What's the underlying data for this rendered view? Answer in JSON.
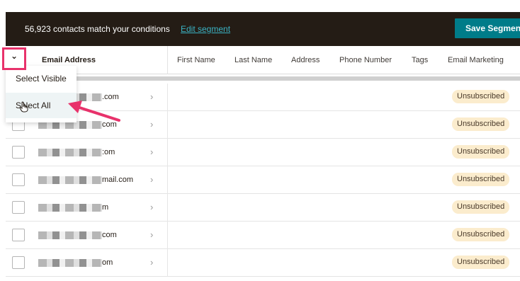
{
  "toolbar": {
    "match_text": "56,923 contacts match your conditions",
    "edit_link": "Edit segment",
    "save_label": "Save Segment"
  },
  "table": {
    "columns": [
      "Email Address",
      "First Name",
      "Last Name",
      "Address",
      "Phone Number",
      "Tags",
      "Email Marketing"
    ],
    "rows": [
      {
        "email_domain": ".com",
        "status": "Unsubscribed"
      },
      {
        "email_domain": "com",
        "status": "Unsubscribed"
      },
      {
        "email_domain": ":om",
        "status": "Unsubscribed"
      },
      {
        "email_domain": "mail.com",
        "status": "Unsubscribed"
      },
      {
        "email_domain": "m",
        "status": "Unsubscribed"
      },
      {
        "email_domain": "com",
        "status": "Unsubscribed"
      },
      {
        "email_domain": "om",
        "status": "Unsubscribed"
      }
    ]
  },
  "select_menu": {
    "toggle_icon": "chevron-down-icon",
    "items": [
      "Select Visible",
      "Select All"
    ]
  },
  "colors": {
    "topbar": "#241c15",
    "save_button": "#007c89",
    "link": "#3ab3c4",
    "highlight": "#e8326b",
    "badge_bg": "#fbeccd"
  }
}
